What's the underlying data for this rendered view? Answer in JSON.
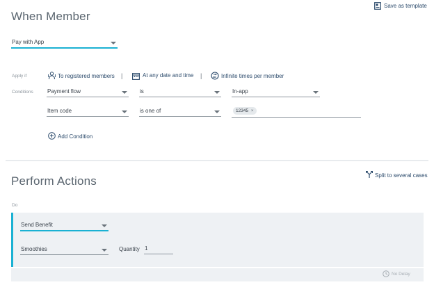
{
  "header": {
    "title": "When Member",
    "save_template_label": "Save as template"
  },
  "trigger": {
    "selected": "Pay with App"
  },
  "apply_if": {
    "label": "Apply if",
    "registered": "To registered members",
    "sep1": "|",
    "date_time": "At any date and time",
    "sep2": "|",
    "times": "Infinite times per member"
  },
  "conditions": {
    "label": "Conditions",
    "rows": [
      {
        "field": "Payment flow",
        "operator": "is",
        "value": "In-app"
      },
      {
        "field": "Item code",
        "operator": "is one of",
        "tags": [
          "12345"
        ]
      }
    ],
    "add_label": "Add Condition"
  },
  "actions": {
    "title": "Perform Actions",
    "split_label": "Split to several cases",
    "do_label": "Do",
    "action_type": "Send Benefit",
    "benefit": "Smoothies",
    "quantity_label": "Quantity",
    "quantity_value": "1",
    "delay_label": "No Delay"
  },
  "colors": {
    "accent": "#1ab1d3",
    "link": "#2b4a6b",
    "panel": "#eef1f4"
  }
}
